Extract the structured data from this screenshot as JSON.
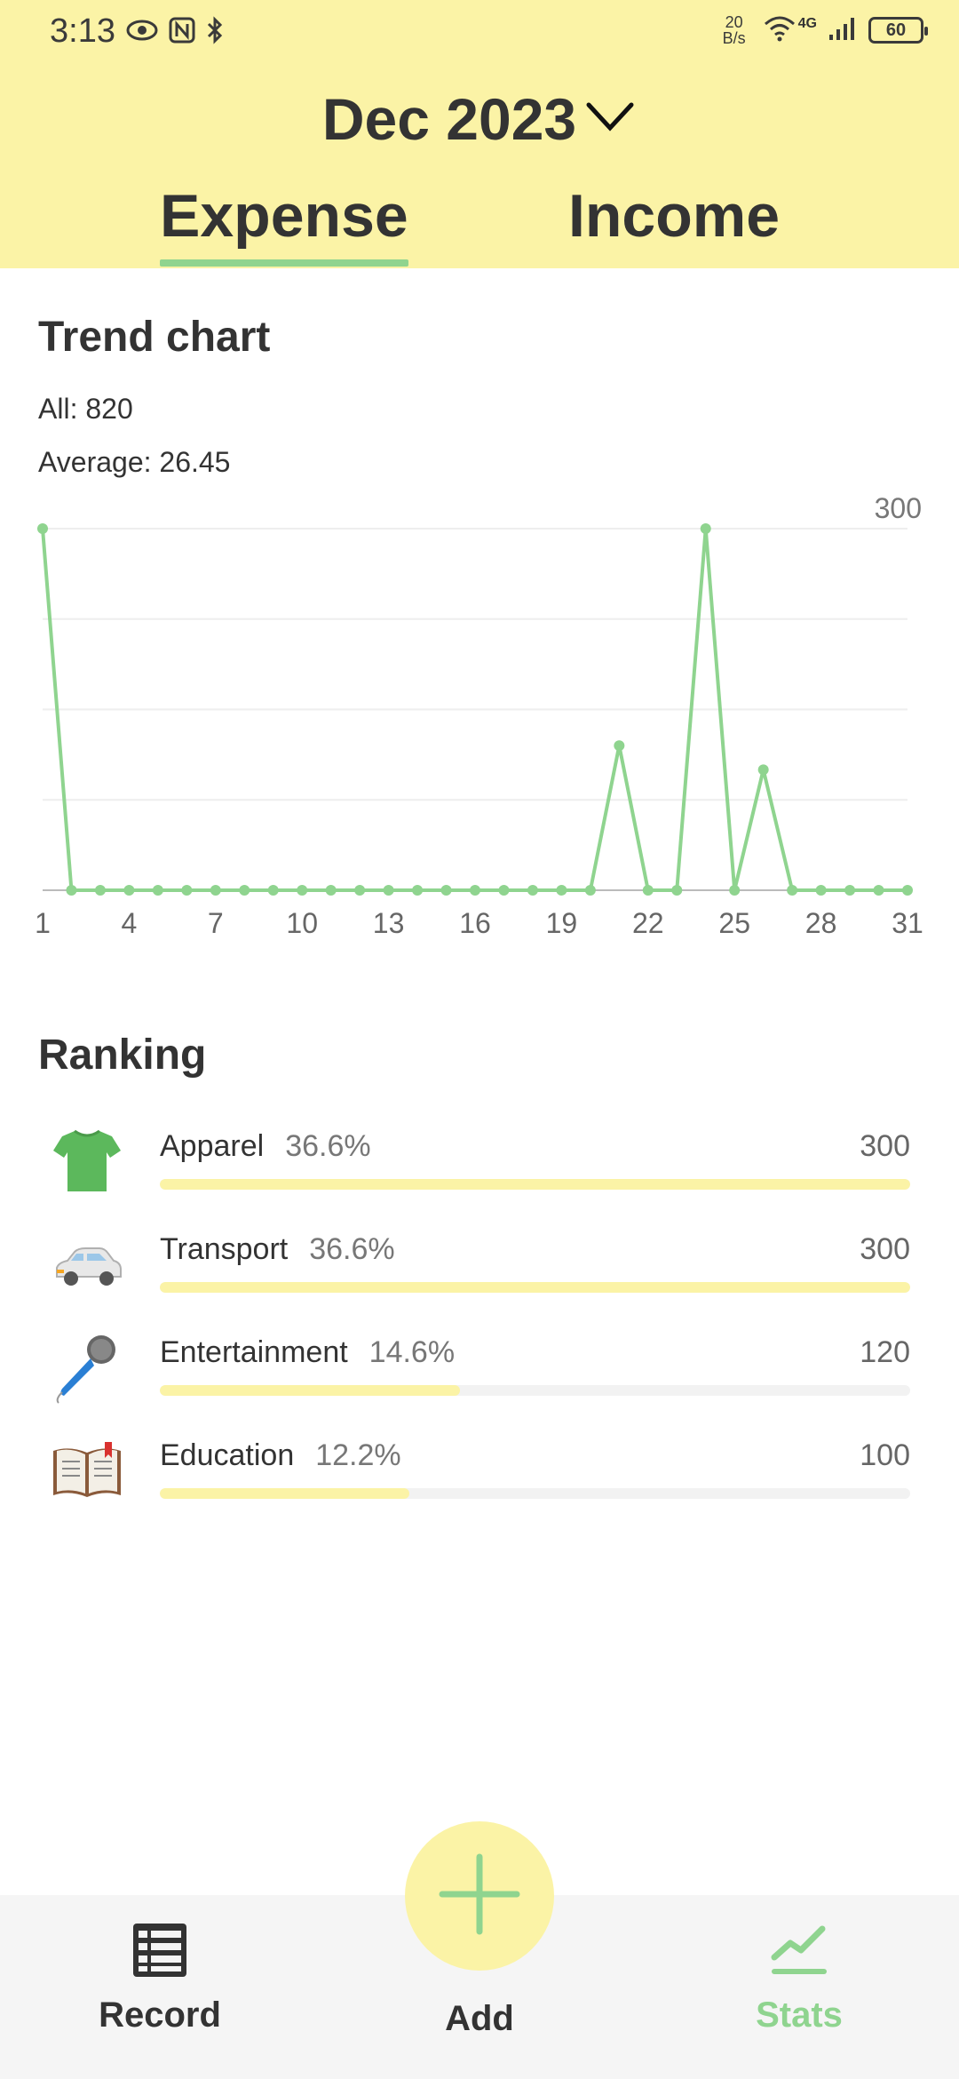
{
  "status_bar": {
    "time": "3:13",
    "net_speed_top": "20",
    "net_speed_bottom": "B/s",
    "network": "4G",
    "battery": "60"
  },
  "header": {
    "month": "Dec 2023",
    "tabs": [
      {
        "label": "Expense",
        "active": true
      },
      {
        "label": "Income",
        "active": false
      }
    ]
  },
  "trend": {
    "title": "Trend chart",
    "all": "All: 820",
    "average": "Average: 26.45"
  },
  "chart_data": {
    "type": "line",
    "x": [
      1,
      2,
      3,
      4,
      5,
      6,
      7,
      8,
      9,
      10,
      11,
      12,
      13,
      14,
      15,
      16,
      17,
      18,
      19,
      20,
      21,
      22,
      23,
      24,
      25,
      26,
      27,
      28,
      29,
      30,
      31
    ],
    "series": [
      {
        "values": [
          300,
          0,
          0,
          0,
          0,
          0,
          0,
          0,
          0,
          0,
          0,
          0,
          0,
          0,
          0,
          0,
          0,
          0,
          0,
          0,
          120,
          0,
          0,
          300,
          0,
          100,
          0,
          0,
          0,
          0,
          0
        ],
        "color": "#8fd48f"
      }
    ],
    "x_tick_labels": [
      "1",
      "4",
      "7",
      "10",
      "13",
      "16",
      "19",
      "22",
      "25",
      "28",
      "31"
    ],
    "y_max_label": "300",
    "ylim": [
      0,
      300
    ],
    "grid": true
  },
  "ranking": {
    "title": "Ranking",
    "items": [
      {
        "name": "Apparel",
        "pct": "36.6%",
        "amount": "300",
        "fraction": 1.0,
        "icon": "tshirt-icon"
      },
      {
        "name": "Transport",
        "pct": "36.6%",
        "amount": "300",
        "fraction": 1.0,
        "icon": "car-icon"
      },
      {
        "name": "Entertainment",
        "pct": "14.6%",
        "amount": "120",
        "fraction": 0.4,
        "icon": "microphone-icon"
      },
      {
        "name": "Education",
        "pct": "12.2%",
        "amount": "100",
        "fraction": 0.333,
        "icon": "book-icon"
      }
    ]
  },
  "nav": {
    "record": "Record",
    "add": "Add",
    "stats": "Stats"
  },
  "colors": {
    "header_bg": "#fbf3a6",
    "accent_green": "#8fd48f",
    "bar_fill": "#fbf3a6"
  }
}
